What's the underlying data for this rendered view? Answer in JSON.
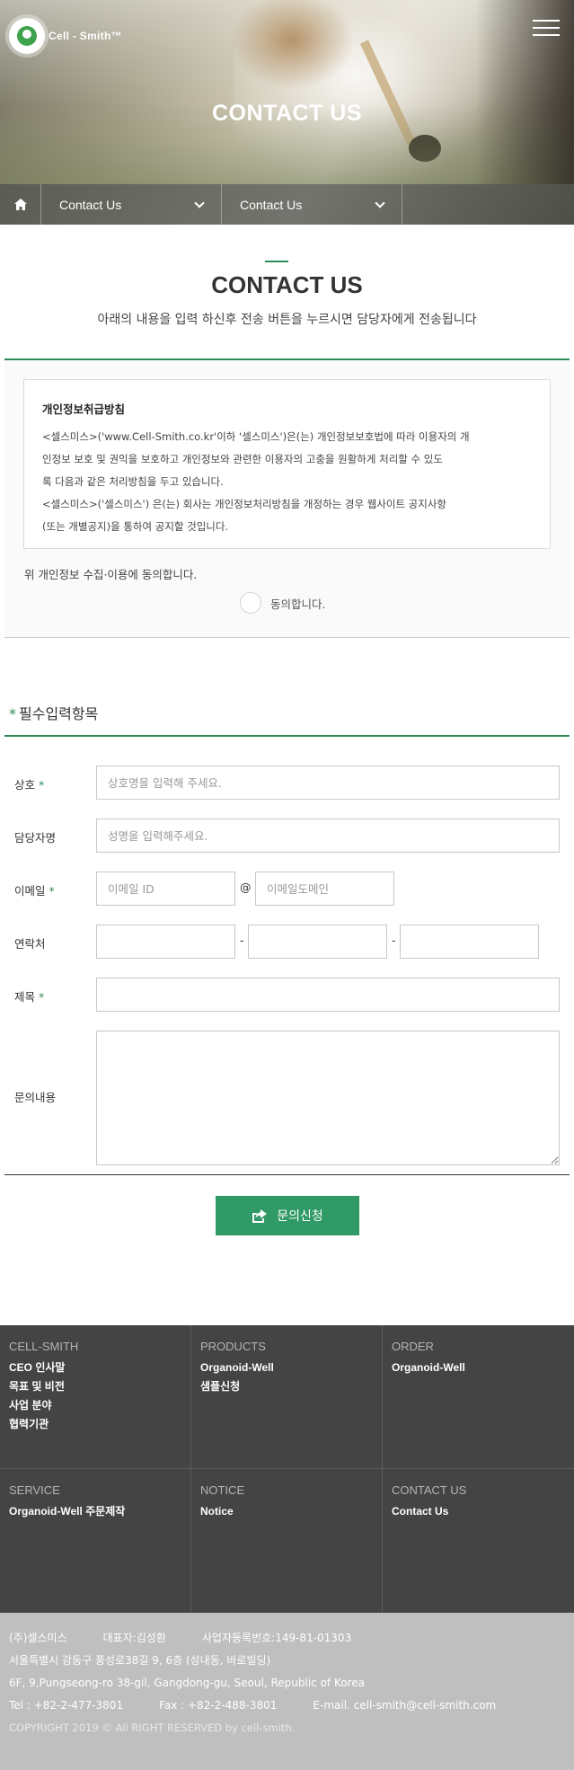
{
  "header": {
    "logo_text": "Cell - Smith™",
    "hero_title": "CONTACT US",
    "subnav": [
      {
        "label": "Contact Us"
      },
      {
        "label": "Contact Us"
      }
    ]
  },
  "intro": {
    "title": "CONTACT US",
    "description": "아래의 내용을 입력 하신후 전송 버튼을 누르시면 담당자에게 전송됩니다"
  },
  "privacy": {
    "heading": "개인정보취급방침",
    "paragraph1_line1": "<셀스미스>('www.Cell-Smith.co.kr'이하 '셀스미스')은(는) 개인정보보호법에 따라 이용자의 개",
    "paragraph1_line2": "인정보 보호 및 권익을 보호하고 개인정보와 관련한 이용자의 고충을 원활하게 처리할 수 있도",
    "paragraph1_line3": "록 다음과 같은 처리방침을 두고 있습니다.",
    "paragraph2_line1": "<셀스미스>('셀스미스') 은(는) 회사는 개인정보처리방침을 개정하는 경우 웹사이트 공지사항",
    "paragraph2_line2": "(또는 개별공지)을 통하여 공지할 것입니다.",
    "agree_question": "위 개인정보 수집·이용에 동의합니다.",
    "agree_label": "동의합니다."
  },
  "form": {
    "required_star": "*",
    "required_title": "필수입력항목",
    "company_label": "상호",
    "company_placeholder": "상호명을 입력해 주세요.",
    "contact_name_label": "담당자명",
    "contact_name_placeholder": "성명을 입력해주세요.",
    "email_label": "이메일",
    "email_id_placeholder": "이메일 ID",
    "email_at": "@",
    "email_domain_placeholder": "이메일도메인",
    "phone_label": "연락처",
    "phone_dash": "-",
    "subject_label": "제목",
    "message_label": "문의내용",
    "submit_label": "문의신청"
  },
  "footer": {
    "columns": [
      {
        "title": "CELL-SMITH",
        "links": [
          "CEO 인사말",
          "목표 및 비전",
          "사업 분야",
          "협력기관"
        ]
      },
      {
        "title": "PRODUCTS",
        "links": [
          "Organoid-Well",
          "샘플신청"
        ]
      },
      {
        "title": "ORDER",
        "links": [
          "Organoid-Well"
        ]
      },
      {
        "title": "SERVICE",
        "links": [
          "Organoid-Well 주문제작"
        ]
      },
      {
        "title": "NOTICE",
        "links": [
          "Notice"
        ]
      },
      {
        "title": "CONTACT US",
        "links": [
          "Contact Us"
        ]
      }
    ],
    "company": "(주)셀스미스",
    "ceo": "대표자:김성환",
    "reg_no": "사업자등록번호:149-81-01303",
    "address_ko": "서울특별시 강동구 풍성로38길 9, 6층 (성내동, 바로빌딩)",
    "address_en": "6F, 9,Pungseong-ro 38-gil, Gangdong-gu, Seoul, Republic of Korea",
    "tel": "Tel : +82-2-477-3801",
    "fax": "Fax : +82-2-488-3801",
    "email": "E-mail. cell-smith@cell-smith.com",
    "copyright": "COPYRIGHT 2019 © All RIGHT RESERVED by cell-smith."
  },
  "colors": {
    "accent_green": "#2e8b57",
    "button_green": "#2f9a66",
    "footer_dark": "#444444",
    "footer_light": "#bfbfbf"
  }
}
